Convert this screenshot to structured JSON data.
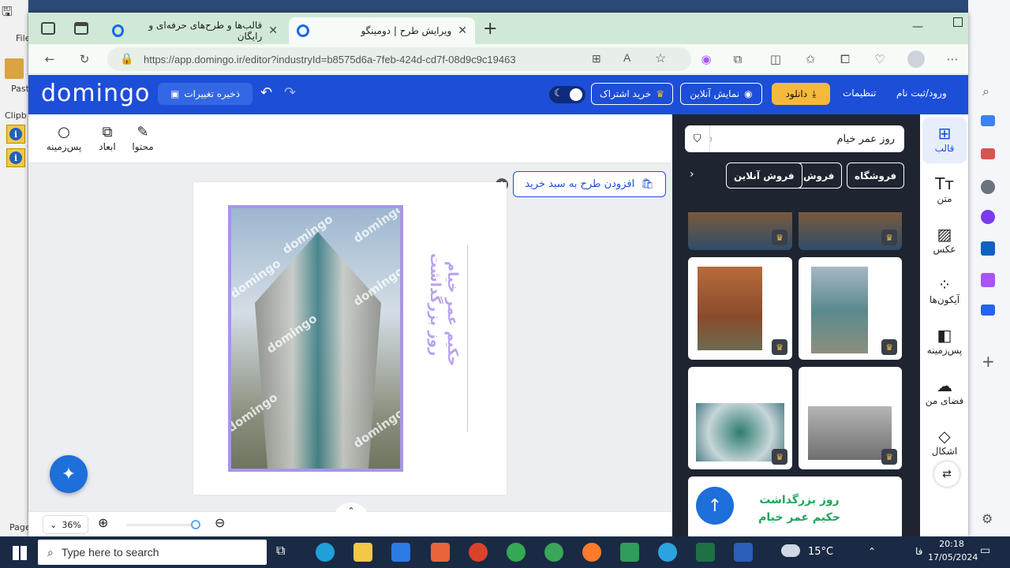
{
  "background_app": {
    "file_label": "File",
    "paste_label": "Past",
    "clipboard_label": "Clipb",
    "page_label": "Page"
  },
  "browser": {
    "tabs": [
      {
        "label": "قالب‌ها و طرح‌های حرفه‌ای و رایگان"
      },
      {
        "label": "ویرایش طرح | دومینگو"
      }
    ],
    "url": "https://app.domingo.ir/editor?industryId=b8575d6a-7feb-424d-cd7f-08d9c9c19463"
  },
  "header": {
    "logo": "domingo",
    "save_label": "ذخیره تغییرات",
    "subscribe_label": "خرید اشتراک",
    "preview_label": "نمایش آنلاین",
    "download_label": "دانلود",
    "settings_label": "تنظیمات",
    "login_label": "ورود/ثبت نام"
  },
  "toolbar": {
    "content_label": "محتوا",
    "dimensions_label": "ابعاد",
    "background_label": "پس‌زمینه"
  },
  "canvas": {
    "add_to_cart_label": "افزودن طرح به سبد خرید",
    "watermark": "domingo",
    "vertical_text_1": "روز بزرگداشت",
    "vertical_text_2": "حکیم عمر خیام",
    "zoom_level": "36%"
  },
  "panel": {
    "search_value": "روز عمر خیام",
    "chips": [
      "فروشگاه",
      "فروش",
      "فروش آنلاین"
    ],
    "last_thumb_line1": "روز بزرگداشت",
    "last_thumb_line2": "حکیم عمر خیام"
  },
  "nav": {
    "items": [
      {
        "label": "قالب"
      },
      {
        "label": "متن"
      },
      {
        "label": "عکس"
      },
      {
        "label": "آیکون‌ها"
      },
      {
        "label": "پس‌زمینه"
      },
      {
        "label": "فضای من"
      },
      {
        "label": "اشکال"
      }
    ]
  },
  "taskbar": {
    "search_placeholder": "Type here to search",
    "temperature": "15°C",
    "language": "فا",
    "time": "20:18",
    "date": "17/05/2024"
  },
  "colors": {
    "brand_blue": "#1d4ed8",
    "panel_dark": "#1e2430",
    "download_yellow": "#f6b93b"
  }
}
